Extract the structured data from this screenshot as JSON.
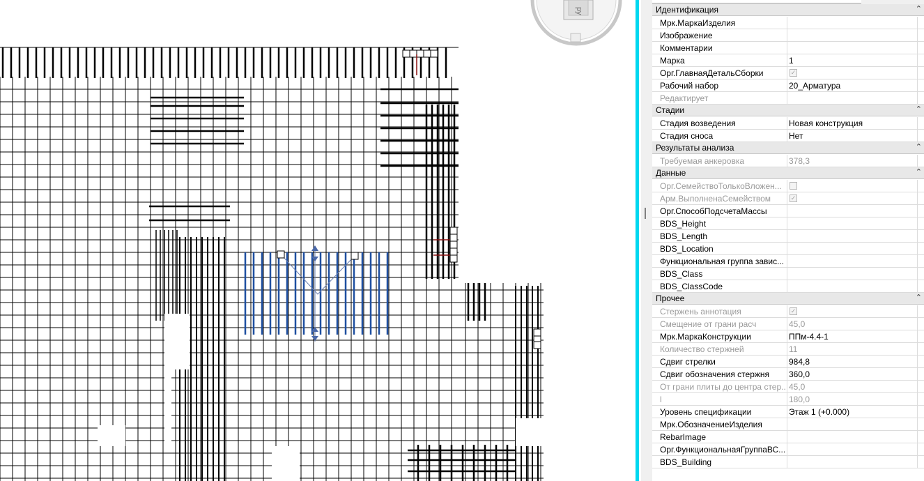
{
  "viewcube": {
    "label": "ру"
  },
  "sections": [
    {
      "key": "identification",
      "title": "Идентификация",
      "rows": [
        {
          "name": "Мрк.МаркаИзделия",
          "value": ""
        },
        {
          "name": "Изображение",
          "value": ""
        },
        {
          "name": "Комментарии",
          "value": ""
        },
        {
          "name": "Марка",
          "value": "1"
        },
        {
          "name": "Орг.ГлавнаяДетальСборки",
          "checkbox": true,
          "checked": true
        },
        {
          "name": "Рабочий набор",
          "value": "20_Арматура"
        },
        {
          "name": "Редактирует",
          "value": "",
          "disabled": true
        }
      ]
    },
    {
      "key": "phasing",
      "title": "Стадии",
      "rows": [
        {
          "name": "Стадия возведения",
          "value": "Новая конструкция"
        },
        {
          "name": "Стадия сноса",
          "value": "Нет"
        }
      ]
    },
    {
      "key": "analysis",
      "title": "Результаты анализа",
      "rows": [
        {
          "name": "Требуемая анкеровка",
          "value": "378,3",
          "disabled": true
        }
      ]
    },
    {
      "key": "data",
      "title": "Данные",
      "rows": [
        {
          "name": "Орг.СемействоТолькоВложен...",
          "checkbox": true,
          "checked": false,
          "disabled": true
        },
        {
          "name": "Арм.ВыполненаСемейством",
          "checkbox": true,
          "checked": true,
          "disabled": true
        },
        {
          "name": "Орг.СпособПодсчетаМассы",
          "value": ""
        },
        {
          "name": "BDS_Height",
          "value": ""
        },
        {
          "name": "BDS_Length",
          "value": ""
        },
        {
          "name": "BDS_Location",
          "value": ""
        },
        {
          "name": "Функциональная группа завис...",
          "value": ""
        },
        {
          "name": "BDS_Class",
          "value": ""
        },
        {
          "name": "BDS_ClassCode",
          "value": ""
        }
      ]
    },
    {
      "key": "other",
      "title": "Прочее",
      "rows": [
        {
          "name": "Стержень аннотация",
          "checkbox": true,
          "checked": true,
          "disabled": true
        },
        {
          "name": "Смещение от грани расч",
          "value": "45,0",
          "disabled": true
        },
        {
          "name": "Мрк.МаркаКонструкции",
          "value": "ППм-4.4-1"
        },
        {
          "name": "Количество стержней",
          "value": "11",
          "disabled": true
        },
        {
          "name": "Сдвиг стрелки",
          "value": "984,8"
        },
        {
          "name": "Сдвиг обозначения стержня",
          "value": "360,0"
        },
        {
          "name": "От грани плиты до центра стер...",
          "value": "45,0",
          "disabled": true
        },
        {
          "name": "l",
          "value": "180,0",
          "disabled": true
        },
        {
          "name": "Уровень спецификации",
          "value": "Этаж 1 (+0.000)"
        },
        {
          "name": "Мрк.ОбозначениеИзделия",
          "value": ""
        },
        {
          "name": "RebarImage",
          "value": ""
        },
        {
          "name": "Орг.ФункциональнаяГруппаВС...",
          "value": ""
        },
        {
          "name": "BDS_Building",
          "value": ""
        }
      ]
    }
  ],
  "icons": {
    "collapse": "double-chevron-up-icon"
  },
  "colors": {
    "splitter": "#00d8f0",
    "selected_rebar": "#1e4fa0",
    "section_bg": "#e8e8e8",
    "disabled_text": "#9a9a9a"
  }
}
